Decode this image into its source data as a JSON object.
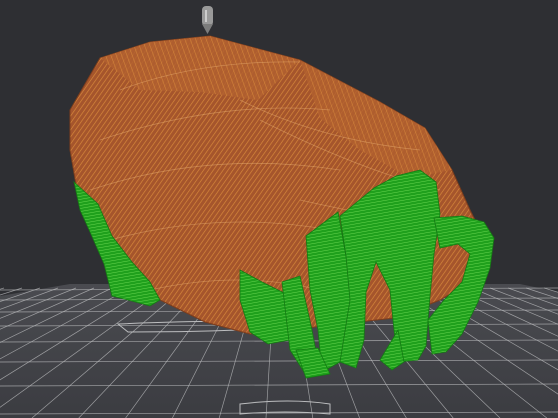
{
  "viewer": {
    "view": "3d-slice-preview",
    "colors": {
      "background": "#2e2f33",
      "build_plate": "#4a4b50",
      "plate_grid": "#bcbdbf",
      "model_outer_wall": "#a5552c",
      "model_infill_lines": "#d98a3c",
      "support_material": "#1fa01c",
      "support_highlight": "#6fdc55",
      "nozzle": "#9a9a9a"
    },
    "legend": [],
    "icons": [
      "nozzle-icon"
    ]
  }
}
